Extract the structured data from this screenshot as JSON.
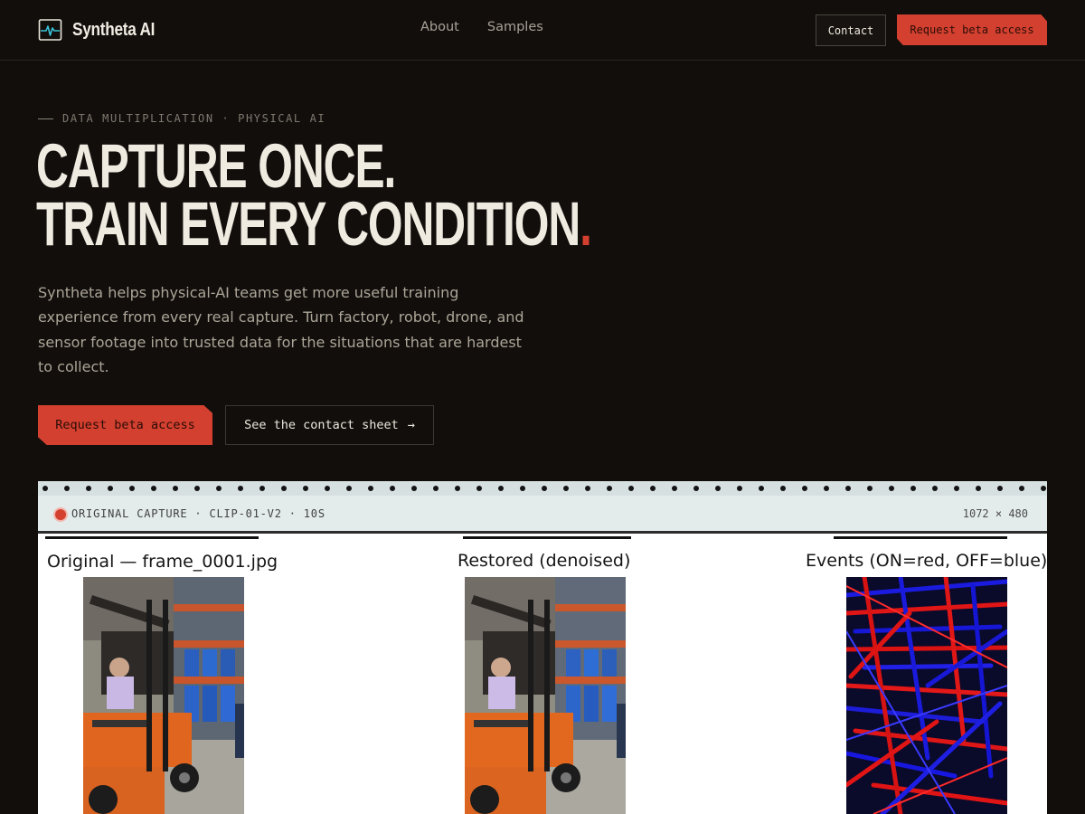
{
  "nav": {
    "brand": "Syntheta AI",
    "links": [
      "About",
      "Samples"
    ],
    "contact_label": "Contact",
    "cta_label": "Request beta access"
  },
  "hero": {
    "eyebrow": "DATA MULTIPLICATION · PHYSICAL AI",
    "headline_line1": "CAPTURE ONCE.",
    "headline_line2": "TRAIN EVERY CONDITION",
    "headline_dot": ".",
    "lede": "Syntheta helps physical-AI teams get more useful training experience from every real capture. Turn factory, robot, drone, and sensor footage into trusted data for the situations that are hardest to collect.",
    "primary_cta": "Request beta access",
    "secondary_cta": "See the contact sheet",
    "secondary_arrow": "→"
  },
  "capture": {
    "label": "ORIGINAL CAPTURE · CLIP-01-V2 · 10S",
    "resolution": "1072 × 480",
    "panels": [
      {
        "title": "Original — frame_0001.jpg"
      },
      {
        "title": "Restored (denoised)"
      },
      {
        "title": "Events (ON=red, OFF=blue)"
      }
    ]
  },
  "colors": {
    "background": "#110e0c",
    "accent": "#d3402f",
    "text": "#efebe0",
    "muted": "#aca597"
  },
  "icons": {
    "brand": "waveform-monitor-icon",
    "recording": "record-dot-icon",
    "arrow": "arrow-right-icon"
  }
}
